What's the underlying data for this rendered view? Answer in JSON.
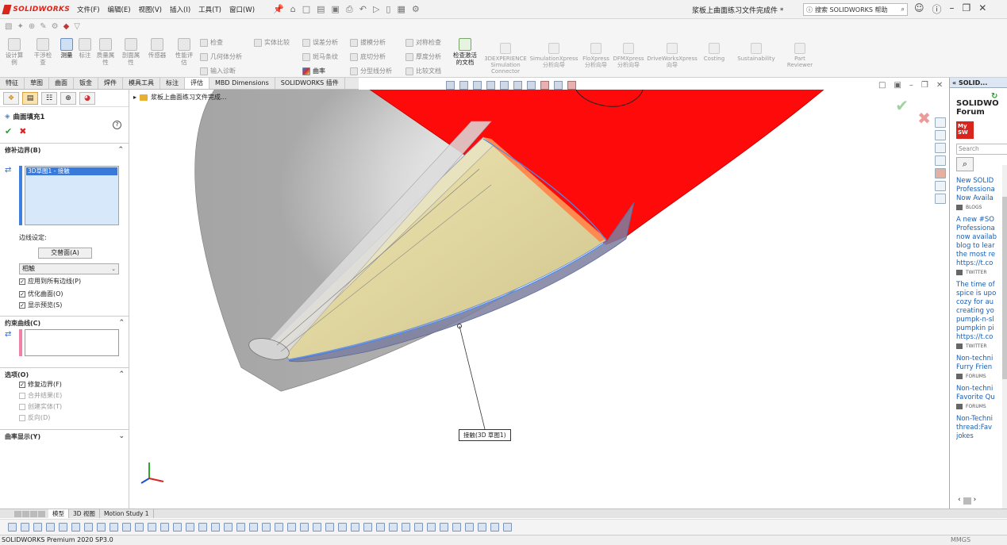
{
  "app": {
    "brand": "SOLIDWORKS",
    "document_title": "浆板上曲面练习文件完成件 *",
    "search_placeholder": "搜索 SOLIDWORKS 帮助"
  },
  "menu": [
    "文件(F)",
    "编辑(E)",
    "视图(V)",
    "插入(I)",
    "工具(T)",
    "窗口(W)"
  ],
  "commands": {
    "big": [
      {
        "label": "设计算例",
        "active": false
      },
      {
        "label": "干涉检查",
        "active": false
      },
      {
        "label": "测量",
        "active": true
      },
      {
        "label": "标注",
        "active": false
      },
      {
        "label": "质量属性",
        "active": false
      },
      {
        "label": "剖面属性",
        "active": false
      },
      {
        "label": "传感器",
        "active": false
      },
      {
        "label": "性能评估",
        "active": false
      }
    ],
    "small": [
      {
        "label": "检查",
        "on": false
      },
      {
        "label": "几何体分析",
        "on": false
      },
      {
        "label": "输入诊断",
        "on": false
      },
      {
        "label": "实体比较",
        "on": false
      },
      {
        "label": "误差分析",
        "on": false
      },
      {
        "label": "斑马条纹",
        "on": false
      },
      {
        "label": "曲率",
        "on": true
      },
      {
        "label": "拔模分析",
        "on": false
      },
      {
        "label": "底切分析",
        "on": false
      },
      {
        "label": "分型线分析",
        "on": false
      },
      {
        "label": "对称检查",
        "on": false
      },
      {
        "label": "厚度分析",
        "on": false
      },
      {
        "label": "比较文档",
        "on": false
      }
    ],
    "check_active": "检查激活的文档",
    "extensions": [
      "3DEXPERIENCE Simulation Connector",
      "SimulationXpress 分析向导",
      "FloXpress 分析向导",
      "DFMXpress 分析向导",
      "DriveWorksXpress 向导",
      "Costing",
      "Sustainability",
      "Part Reviewer"
    ]
  },
  "tabs": [
    {
      "label": "特征",
      "active": false
    },
    {
      "label": "草图",
      "active": false
    },
    {
      "label": "曲面",
      "active": false
    },
    {
      "label": "钣金",
      "active": false
    },
    {
      "label": "焊件",
      "active": false
    },
    {
      "label": "模具工具",
      "active": false
    },
    {
      "label": "标注",
      "active": false
    },
    {
      "label": "评估",
      "active": true
    },
    {
      "label": "MBD Dimensions",
      "active": false
    },
    {
      "label": "SOLIDWORKS 插件",
      "active": false
    }
  ],
  "property_manager": {
    "feature_name": "曲面填充1",
    "groups": {
      "patch_boundary": "修补边界(B)",
      "constraint_curves": "约束曲线(C)",
      "options": "选项(O)",
      "curvature_display": "曲率显示(Y)"
    },
    "boundary_item": "3D草图1 - 接触",
    "edge_settings_label": "边线设定:",
    "alternate_face_button": "交替面(A)",
    "edge_type": "相触",
    "checkboxes": [
      {
        "label": "应用到所有边线(P)",
        "checked": true
      },
      {
        "label": "优化曲面(O)",
        "checked": true
      },
      {
        "label": "显示预览(S)",
        "checked": true
      }
    ],
    "options": [
      {
        "label": "修复边界(F)",
        "checked": true,
        "enabled": true
      },
      {
        "label": "合并结果(E)",
        "checked": false,
        "enabled": false
      },
      {
        "label": "创建实体(T)",
        "checked": false,
        "enabled": false
      },
      {
        "label": "反向(D)",
        "checked": false,
        "enabled": false
      }
    ]
  },
  "viewport": {
    "tree_root": "浆板上曲面练习文件完成...",
    "callout": "接触(3D 草图1)"
  },
  "taskpane": {
    "header": "SOLID...",
    "brand_line1": "SOLIDWO",
    "brand_line2": "Forum",
    "mysw_line1": "My",
    "mysw_line2": "SW",
    "search_placeholder": "Search",
    "feed": [
      {
        "lines": [
          "New SOLID",
          "Professiona",
          "Now Availa"
        ],
        "source": "BLOGS"
      },
      {
        "lines": [
          "A new #SO",
          "Professiona",
          "now availab",
          "blog to lear",
          "the most re",
          "https://t.co"
        ],
        "source": "TWITTER"
      },
      {
        "lines": [
          "The time of",
          "spice is upo",
          "cozy for au",
          "creating yo",
          "pumpk-n-sl",
          "pumpkin pi",
          "https://t.co"
        ],
        "source": "TWITTER"
      },
      {
        "lines": [
          "Non-techni",
          "Furry Frien"
        ],
        "source": "FORUMS"
      },
      {
        "lines": [
          "Non-techni",
          "Favorite Qu"
        ],
        "source": "FORUMS"
      },
      {
        "lines": [
          "Non-Techni",
          "thread:Fav",
          "jokes"
        ],
        "source": ""
      }
    ]
  },
  "bottom_tabs": [
    {
      "label": "模型",
      "active": true
    },
    {
      "label": "3D 视图",
      "active": false
    },
    {
      "label": "Motion Study 1",
      "active": false
    }
  ],
  "status": {
    "product": "SOLIDWORKS Premium 2020 SP3.0",
    "units": "MMGS"
  }
}
